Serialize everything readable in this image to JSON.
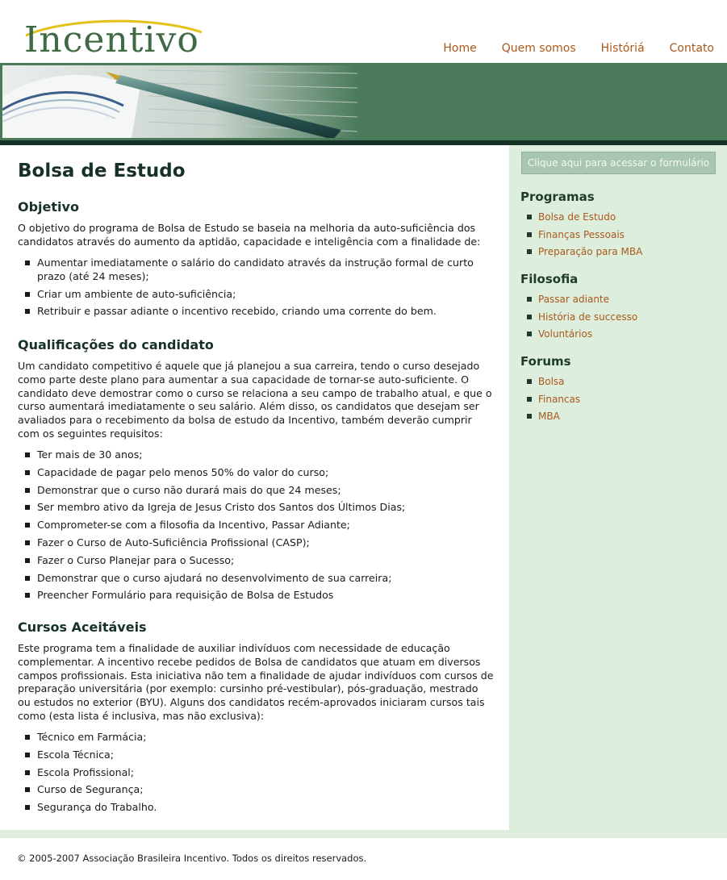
{
  "brand": {
    "name": "Incentivo",
    "colors": {
      "green": "#3f6a45",
      "dark_green": "#163126",
      "link": "#a9581b",
      "sidebar_bg": "#ddeedd"
    }
  },
  "nav": [
    {
      "label": "Home"
    },
    {
      "label": "Quem somos"
    },
    {
      "label": "Históriá"
    },
    {
      "label": "Contato"
    }
  ],
  "main": {
    "title": "Bolsa de Estudo",
    "sections": [
      {
        "heading": "Objetivo",
        "text": "O objetivo do programa de Bolsa de Estudo se baseia na melhoria da auto-suficiência dos candidatos através do aumento da aptidão, capacidade e inteligência com a finalidade de:",
        "items": [
          "Aumentar imediatamente o salário do candidato através da instrução formal de curto prazo (até 24 meses);",
          "Criar um ambiente de auto-suficiência;",
          "Retribuir e passar adiante o incentivo recebido, criando uma corrente do bem."
        ]
      },
      {
        "heading": "Qualificações do candidato",
        "text": "Um candidato competitivo é aquele que já planejou a sua carreira, tendo o curso desejado como parte deste plano para aumentar a sua capacidade de tornar-se auto-suficiente. O candidato deve demostrar como o curso se relaciona a seu campo de trabalho atual, e que o curso aumentará imediatamente o seu salário. Além disso, os candidatos que desejam ser avaliados para o recebimento da bolsa de estudo da Incentivo, também deverão cumprir com os seguintes requisitos:",
        "items": [
          "Ter mais de 30 anos;",
          "Capacidade de pagar pelo menos 50% do valor do curso;",
          "Demonstrar que o curso não durará mais do que 24 meses;",
          "Ser membro ativo da Igreja de Jesus Cristo dos Santos dos Últimos Dias;",
          "Comprometer-se com a filosofia da Incentivo, Passar Adiante;",
          "Fazer o Curso de Auto-Suficiência Profissional (CASP);",
          "Fazer o Curso Planejar para o Sucesso;",
          "Demonstrar que o curso ajudará no desenvolvimento de sua carreira;",
          "Preencher Formulário para requisição de Bolsa de Estudos"
        ]
      },
      {
        "heading": "Cursos Aceitáveis",
        "text": "Este programa tem a finalidade de auxiliar indivíduos com necessidade de educação complementar. A incentivo recebe pedidos de Bolsa de candidatos que atuam em diversos campos profissionais. Esta iniciativa não tem a finalidade de ajudar indivíduos com cursos de preparação universitária (por exemplo: cursinho pré-vestibular), pós-graduação, mestrado ou estudos no exterior (BYU). Alguns dos candidatos recém-aprovados iniciaram cursos tais como (esta lista é inclusiva, mas não exclusiva):",
        "items": [
          "Técnico em Farmácia;",
          "Escola Técnica;",
          "Escola Profissional;",
          "Curso de Segurança;",
          "Segurança do Trabalho."
        ]
      }
    ]
  },
  "sidebar": {
    "form_button": "Clique aqui para acessar o formulário",
    "groups": [
      {
        "heading": "Programas",
        "links": [
          "Bolsa de Estudo",
          "Finanças Pessoais",
          "Preparação para MBA"
        ]
      },
      {
        "heading": "Filosofia",
        "links": [
          "Passar adiante",
          "História de successo",
          "Voluntários"
        ]
      },
      {
        "heading": "Forums",
        "links": [
          "Bolsa",
          "Financas",
          "MBA"
        ]
      }
    ]
  },
  "footer": {
    "text": "© 2005-2007 Associação Brasileira Incentivo. Todos os direitos reservados."
  }
}
